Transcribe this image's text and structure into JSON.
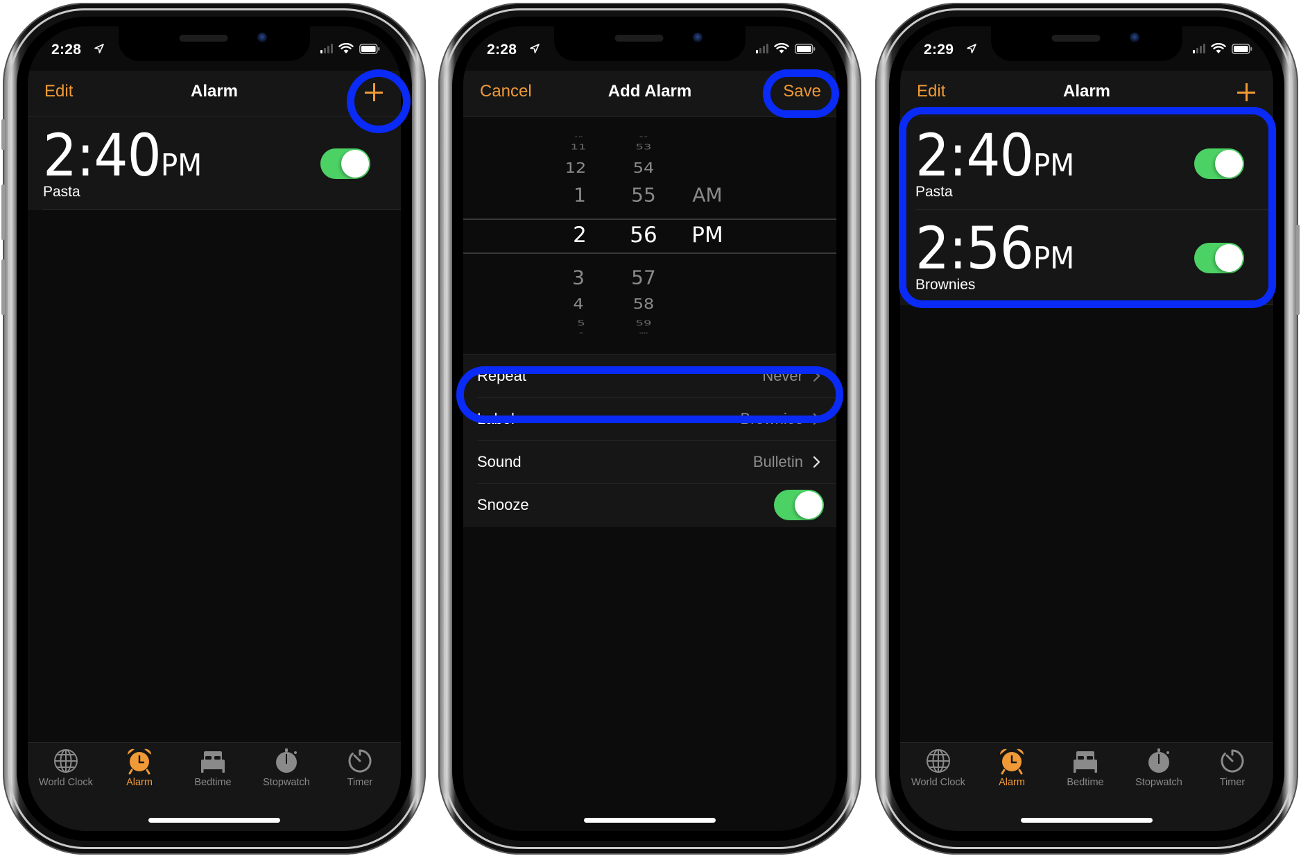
{
  "colors": {
    "accent": "#f09a37",
    "toggle_on": "#4cd164",
    "highlight": "#0a2af5",
    "background": "#0c0c0c",
    "cell": "#161616",
    "secondary_text": "#8d8d8d"
  },
  "tabs": [
    {
      "label": "World Clock",
      "icon": "globe-icon"
    },
    {
      "label": "Alarm",
      "icon": "alarm-clock-icon",
      "active": true
    },
    {
      "label": "Bedtime",
      "icon": "bed-icon"
    },
    {
      "label": "Stopwatch",
      "icon": "stopwatch-icon"
    },
    {
      "label": "Timer",
      "icon": "timer-icon"
    }
  ],
  "phones": [
    {
      "status": {
        "time": "2:28"
      },
      "nav": {
        "left": "Edit",
        "title": "Alarm",
        "right_icon": "plus-icon"
      },
      "alarms": [
        {
          "hour_min": "2:40",
          "ampm": "PM",
          "label": "Pasta",
          "enabled": true
        }
      ],
      "highlight": "add-button"
    },
    {
      "status": {
        "time": "2:28"
      },
      "nav": {
        "left": "Cancel",
        "title": "Add Alarm",
        "right": "Save"
      },
      "picker": {
        "hours": [
          "10",
          "11",
          "12",
          "1",
          "2",
          "3",
          "4",
          "5",
          "6"
        ],
        "minutes": [
          "52",
          "53",
          "54",
          "55",
          "56",
          "57",
          "58",
          "59",
          "00"
        ],
        "periods": [
          "AM",
          "PM"
        ],
        "selected": {
          "hour": "2",
          "minute": "56",
          "period": "PM"
        }
      },
      "settings": [
        {
          "label": "Repeat",
          "value": "Never",
          "type": "disclosure"
        },
        {
          "label": "Label",
          "value": "Brownies",
          "type": "disclosure"
        },
        {
          "label": "Sound",
          "value": "Bulletin",
          "type": "disclosure"
        },
        {
          "label": "Snooze",
          "type": "toggle",
          "enabled": true
        }
      ],
      "highlight": [
        "save-button",
        "label-row"
      ]
    },
    {
      "status": {
        "time": "2:29"
      },
      "nav": {
        "left": "Edit",
        "title": "Alarm",
        "right_icon": "plus-icon"
      },
      "alarms": [
        {
          "hour_min": "2:40",
          "ampm": "PM",
          "label": "Pasta",
          "enabled": true
        },
        {
          "hour_min": "2:56",
          "ampm": "PM",
          "label": "Brownies",
          "enabled": true
        }
      ],
      "highlight": "alarm-list"
    }
  ]
}
